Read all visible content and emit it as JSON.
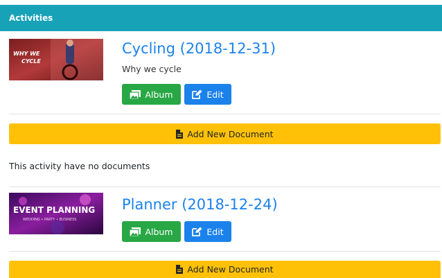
{
  "header": {
    "title": "Activities"
  },
  "activities": [
    {
      "title": "Cycling (2018-12-31)",
      "description": "Why we cycle",
      "thumbnail_text": [
        "WHY WE",
        "CYCLE"
      ],
      "album_label": "Album",
      "edit_label": "Edit",
      "add_document_label": "Add New Document",
      "no_documents_text": "This activity have no documents"
    },
    {
      "title": "Planner (2018-12-24)",
      "description": "",
      "thumbnail_text": [
        "EVENT PLANNING",
        "WEDDING • PARTY • BUSINESS"
      ],
      "album_label": "Album",
      "edit_label": "Edit",
      "add_document_label": "Add New Document"
    }
  ],
  "colors": {
    "header_bg": "#17a2b8",
    "album_button": "#28a745",
    "edit_button": "#1b82ec",
    "add_document_button": "#ffc107",
    "title_link": "#1b82ec"
  },
  "icons": {
    "album": "images-icon",
    "edit": "pencil-square-icon",
    "document": "file-icon"
  }
}
